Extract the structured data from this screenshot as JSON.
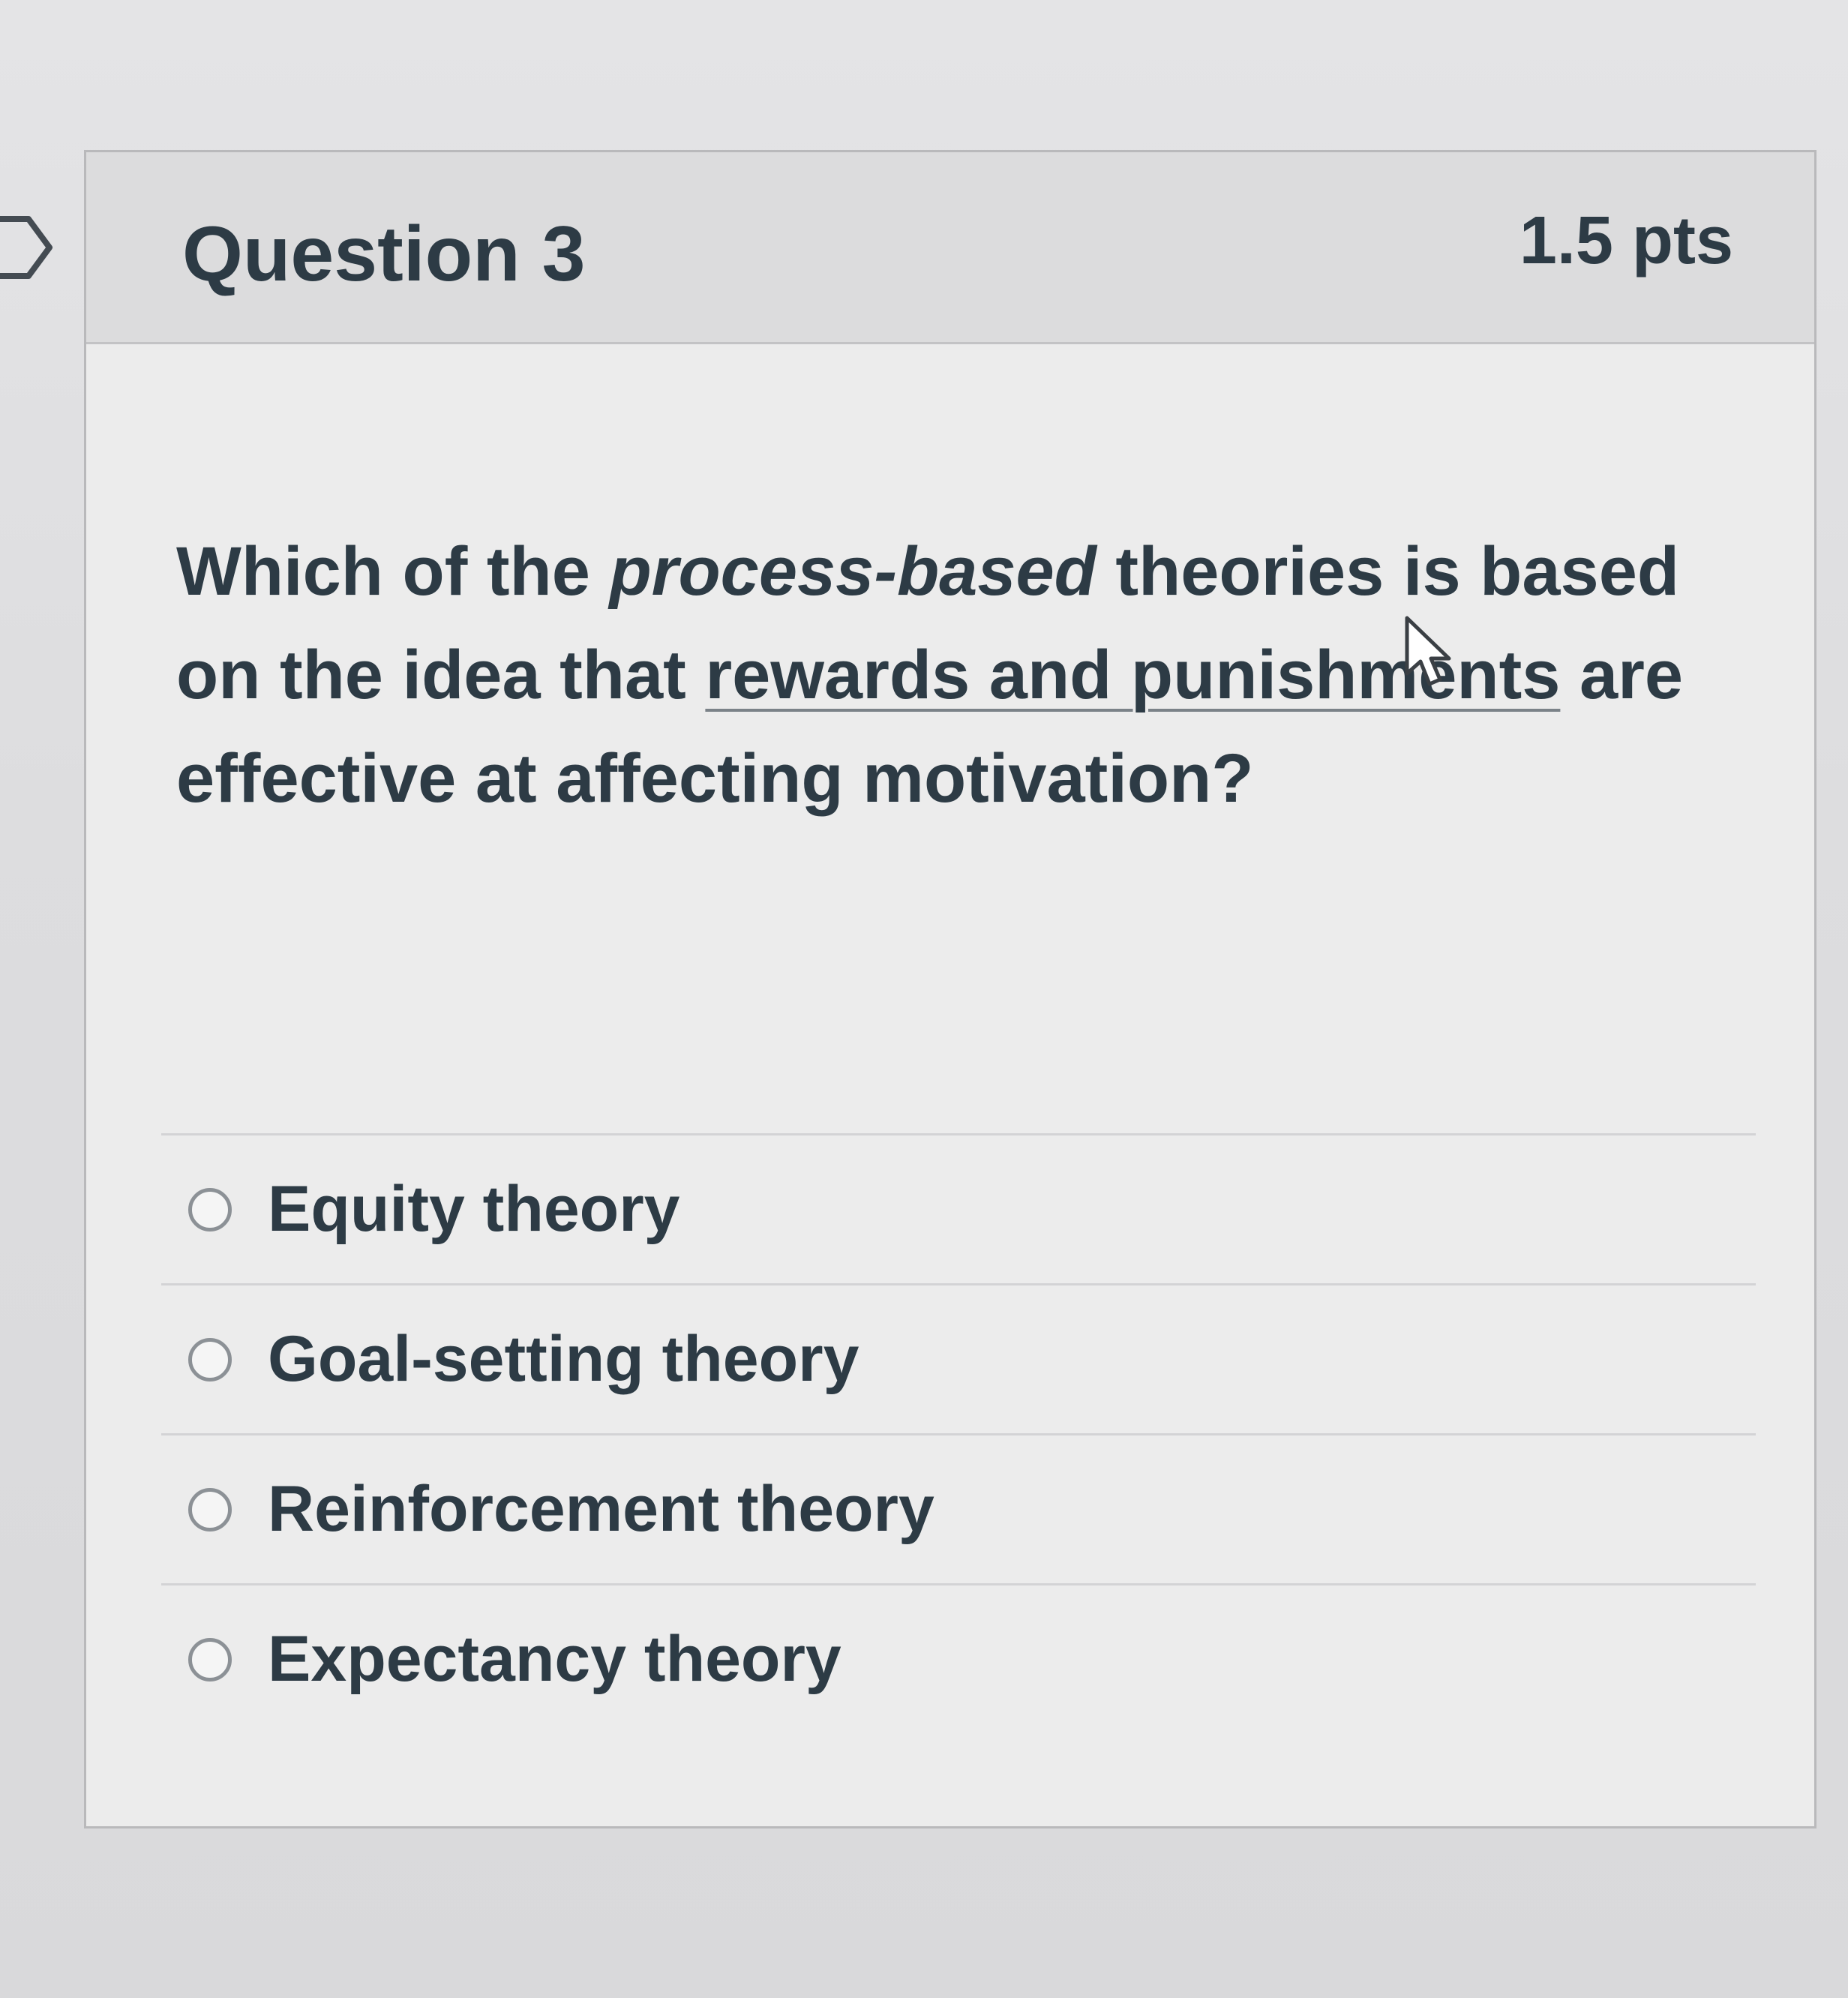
{
  "question": {
    "title": "Question 3",
    "points": "1.5 pts",
    "text_part1": "Which of the ",
    "text_emphasis": "process-based",
    "text_part2": " theories is based on the idea that ",
    "text_underlined": "rewards and punishments",
    "text_part3": " are effective at affecting motivation?"
  },
  "answers": [
    {
      "label": "Equity theory",
      "selected": false
    },
    {
      "label": "Goal-setting theory",
      "selected": false
    },
    {
      "label": "Reinforcement theory",
      "selected": false
    },
    {
      "label": "Expectancy theory",
      "selected": false
    }
  ],
  "icons": {
    "flag": "flag-question-icon",
    "cursor": "mouse-pointer-icon",
    "radio": "radio-unchecked-icon"
  },
  "colors": {
    "text": "#2d3b45",
    "header_bg": "#dcdcdd",
    "card_bg": "#ececec",
    "border": "#b9b9bb"
  }
}
